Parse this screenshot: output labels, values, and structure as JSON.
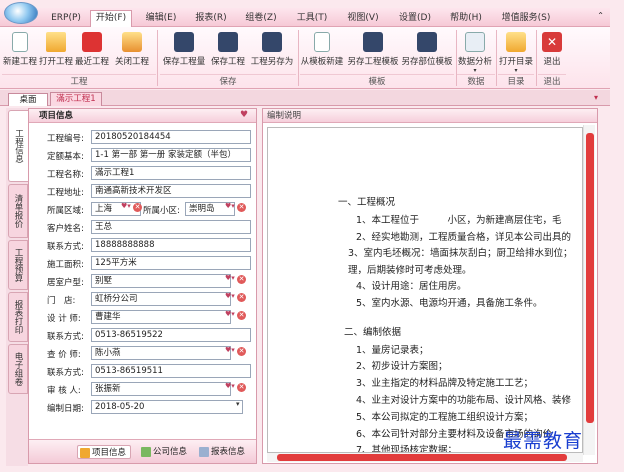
{
  "menu": {
    "items": [
      "ERP(P)",
      "开始(F)",
      "编辑(E)",
      "报表(R)",
      "组卷(Z)",
      "工具(T)",
      "视图(V)",
      "设置(D)",
      "帮助(H)",
      "增值服务(S)"
    ],
    "ctrl": "⌃"
  },
  "ribbon": {
    "buttons": [
      "新建工程",
      "打开工程",
      "最近工程",
      "关闭工程",
      "保存工程量",
      "保存工程",
      "工程另存为",
      "从模板新建",
      "另存工程模板",
      "另存部位模板",
      "数据分析",
      "打开目录",
      "退出"
    ],
    "groups": [
      "工程",
      "保存",
      "模板",
      "数据",
      "目录",
      "退出"
    ]
  },
  "tabs": {
    "desktop": "桌面",
    "project": "滿示工程1"
  },
  "vtabs": [
    "工程信息",
    "清单报价",
    "工程预算",
    "报表打印",
    "电子组卷"
  ],
  "panel": {
    "title": "项目信息",
    "fields": {
      "project_no_label": "工程编号:",
      "project_no": "20180520184454",
      "quota_label": "定额基本:",
      "quota": "1-1 第一部 第一册 家装定额（半包）",
      "name_label": "工程名称:",
      "name": "滿示工程1",
      "address_label": "工程地址:",
      "address": "南通高新技术开发区",
      "region_label": "所属区域:",
      "region": "上海",
      "community_label": "所属小区:",
      "community": "崇明岛",
      "customer_label": "客户姓名:",
      "customer": "王总",
      "contact_label": "联系方式:",
      "contact": "18888888888",
      "area_label": "施工面积:",
      "area": "125平方米",
      "house_type_label": "居室户型:",
      "house_type": "别墅",
      "store_label": "门　店:",
      "store": "虹桥分公司",
      "designer_label": "设 计 师:",
      "designer": "曹建华",
      "designer_contact_label": "联系方式:",
      "designer_contact": "0513-86519522",
      "auditor_label": "查 价 师:",
      "auditor": "陈小燕",
      "auditor_contact_label": "联系方式:",
      "auditor_contact": "0513-86519511",
      "reviewer_label": "审 核 人:",
      "reviewer": "张振新",
      "date_label": "编制日期:",
      "date": "2018-05-20"
    },
    "bottom": [
      "项目信息",
      "公司信息",
      "报表信息"
    ]
  },
  "right": {
    "title": "编制说明",
    "lines": [
      "一、工程概况",
      "1、本工程位于　　　小区，为新建高层住宅，毛",
      "2、经实地勘测，工程质量合格，详见本公司出具的",
      "3、室内毛坯概况：墙面抹灰刮白；厨卫给排水到位；",
      "理，后期装修时可考虑处理。",
      "4、设计用途：居住用房。",
      "5、室内水源、电源均开通，具备施工条件。",
      "二、编制依据",
      "1、量房记录表；",
      "2、初步设计方案图；",
      "3、业主指定的材料品牌及特定施工工艺；",
      "4、业主对设计方案中的功能布局、设计风格、装修",
      "5、本公司拟定的工程施工组织设计方案；",
      "6、本公司针对部分主要材料及设备市场的询价",
      "7、其他现场核定数据；"
    ]
  },
  "watermark": "最需教育"
}
